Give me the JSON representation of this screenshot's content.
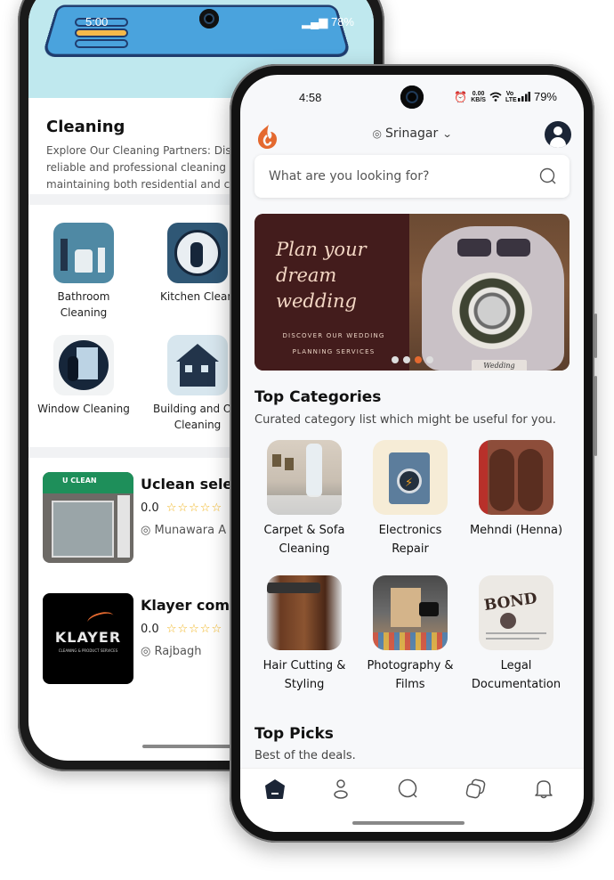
{
  "back_phone": {
    "status_bar": {
      "time": "5:00",
      "battery": "78%"
    },
    "category_page": {
      "title": "Cleaning",
      "description_lines": [
        "Explore Our Cleaning Partners: Disco",
        "reliable and professional cleaning pa",
        "maintaining both residential and con"
      ],
      "subcategories": [
        {
          "label_line1": "Bathroom",
          "label_line2": "Cleaning",
          "icon": "bathroom-cleaning-image"
        },
        {
          "label_line1": "Kitchen Cleani",
          "label_line2": "",
          "icon": "kitchen-cleaning-image"
        },
        {
          "label_line1": "Window Cleaning",
          "label_line2": "",
          "icon": "window-cleaning-image"
        },
        {
          "label_line1": "Building and Of",
          "label_line2": "Cleaning",
          "icon": "building-cleaning-image"
        }
      ],
      "listings": [
        {
          "name": "Uclean select",
          "rating": "0.0",
          "stars": "☆☆☆☆☆",
          "location": "Munawara A",
          "logo_text": "U CLEAN"
        },
        {
          "name": "Klayer compa",
          "rating": "0.0",
          "stars": "☆☆☆☆☆",
          "location": "Rajbagh",
          "logo_text": "KLAYER",
          "logo_sub": "CLEANING & PRODUCT SERVICES"
        }
      ]
    }
  },
  "front_phone": {
    "status_bar": {
      "time": "4:58",
      "data_speed": "0.00",
      "data_unit": "KB/S",
      "volte": "Vo LTE",
      "battery": "79%"
    },
    "header": {
      "location": "Srinagar",
      "pin_icon": "◎",
      "chevron": "⌄"
    },
    "search": {
      "placeholder": "What are you looking for?"
    },
    "banner": {
      "headline": "Plan your dream wedding",
      "subtext_line1": "DISCOVER OUR WEDDING",
      "subtext_line2": "PLANNING SERVICES",
      "plate_text": "Wedding",
      "slide_count": 4,
      "active_slide": 3
    },
    "top_categories": {
      "title": "Top Categories",
      "subtitle": "Curated category list which might be useful for you.",
      "items": [
        {
          "line1": "Carpet & Sofa",
          "line2": "Cleaning"
        },
        {
          "line1": "Electronics",
          "line2": "Repair"
        },
        {
          "line1": "Mehndi (Henna)",
          "line2": ""
        },
        {
          "line1": "Hair Cutting &",
          "line2": "Styling"
        },
        {
          "line1": "Photography &",
          "line2": "Films"
        },
        {
          "line1": "Legal",
          "line2": "Documentation"
        }
      ]
    },
    "top_picks": {
      "title": "Top Picks",
      "subtitle": "Best of the deals."
    },
    "bottom_nav": {
      "items": [
        "home",
        "profile",
        "search",
        "categories",
        "notifications"
      ],
      "active": "home"
    },
    "colors": {
      "brand_orange": "#e4692f",
      "banner_bg": "#431c1c",
      "nav_active": "#1b2536",
      "star": "#f0b31c"
    }
  }
}
